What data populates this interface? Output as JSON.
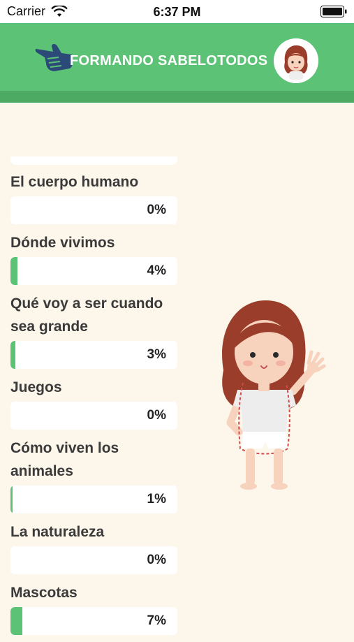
{
  "status_bar": {
    "carrier": "Carrier",
    "time": "6:37 PM"
  },
  "header": {
    "title": "FORMANDO SABELOTODOS"
  },
  "topics": [
    {
      "title": "El cuerpo humano",
      "percent_label": "0%",
      "progress": 0
    },
    {
      "title": "Dónde vivimos",
      "percent_label": "4%",
      "progress": 0.04
    },
    {
      "title": "Qué voy a ser cuando sea grande",
      "percent_label": "3%",
      "progress": 0.03
    },
    {
      "title": "Juegos",
      "percent_label": "0%",
      "progress": 0
    },
    {
      "title": "Cómo viven los animales",
      "percent_label": "1%",
      "progress": 0.01
    },
    {
      "title": "La naturaleza",
      "percent_label": "0%",
      "progress": 0
    },
    {
      "title": "Mascotas",
      "percent_label": "7%",
      "progress": 0.07
    }
  ],
  "colors": {
    "accent": "#5cc276",
    "background": "#fdf6ea",
    "header_shadow": "#4caa62"
  },
  "icons": {
    "header_left": "pointing-hand-icon",
    "header_right": "girl-avatar-icon"
  }
}
